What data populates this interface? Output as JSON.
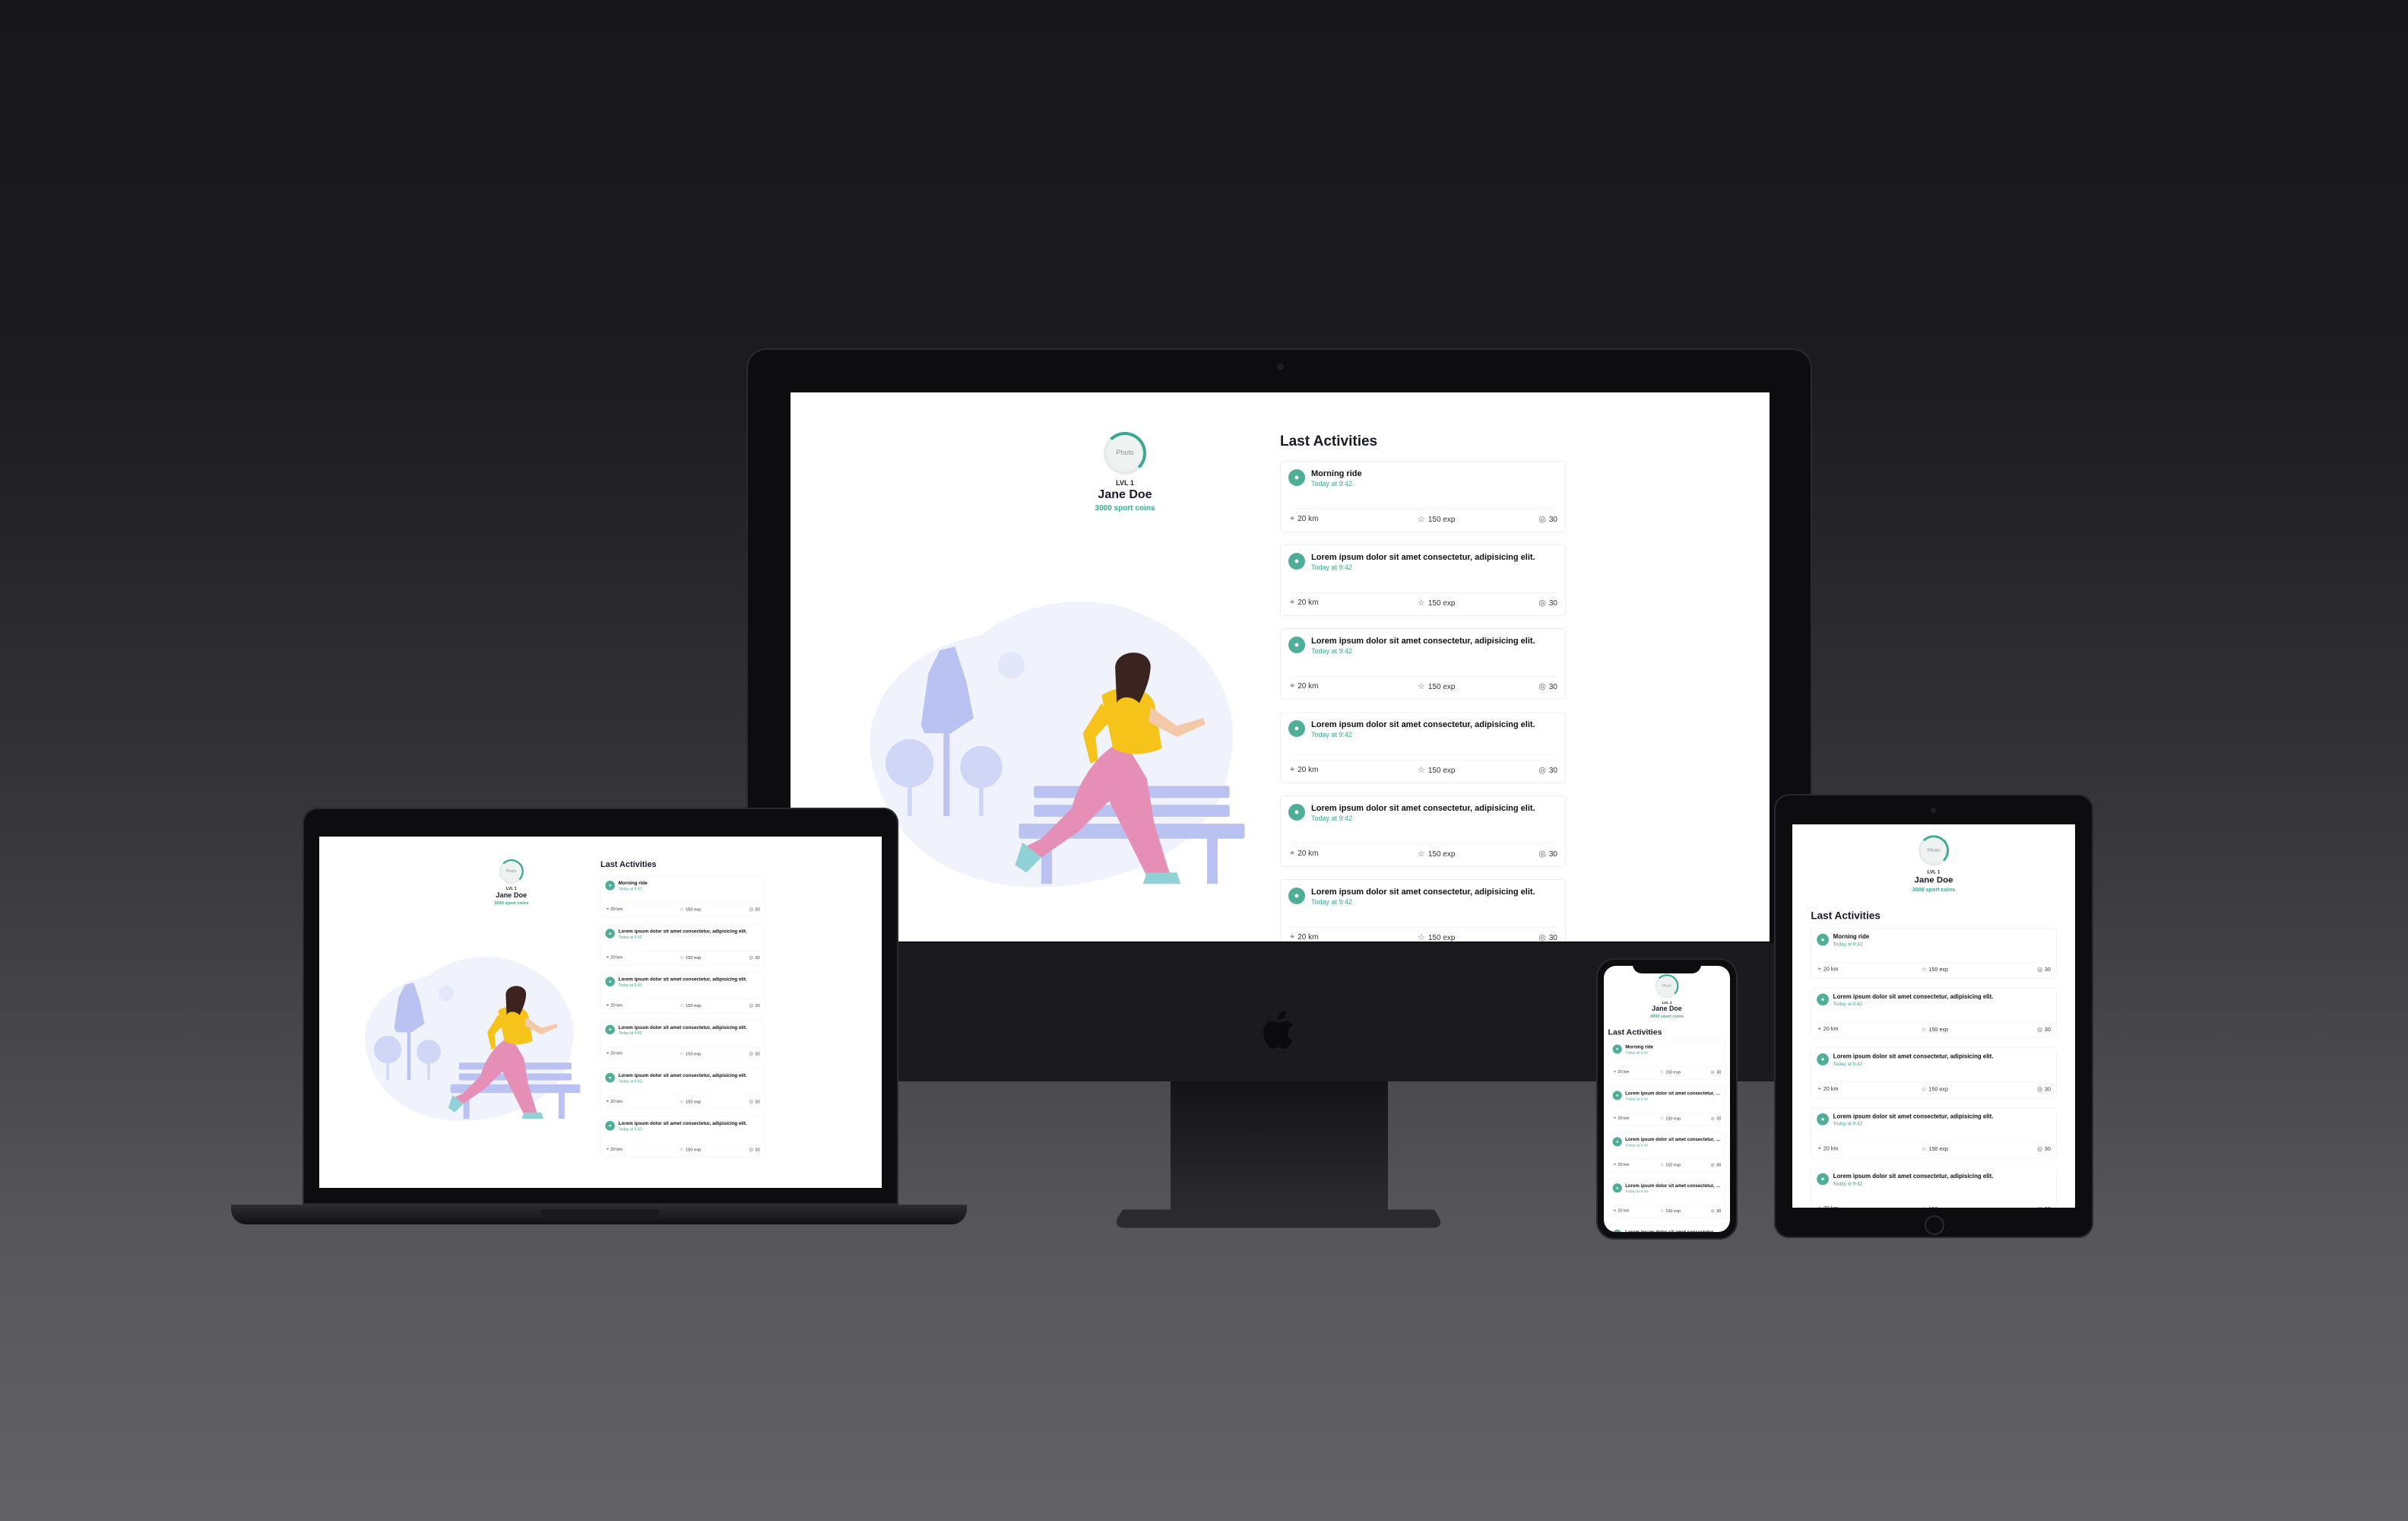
{
  "profile": {
    "photo_label": "Photo",
    "level": "LVL 1",
    "name": "Jane Doe",
    "coins": "3000 sport coins"
  },
  "activities": {
    "title": "Last Activities",
    "items": [
      {
        "title": "Morning ride",
        "time": "Today at 9:42",
        "distance": "20 km",
        "exp": "150 exp",
        "coins": "30",
        "icon": "bike-icon"
      },
      {
        "title": "Lorem ipsum dolor sit amet consectetur, adipisicing elit.",
        "time": "Today at 9:42",
        "distance": "20 km",
        "exp": "150 exp",
        "coins": "30",
        "icon": "run-icon"
      },
      {
        "title": "Lorem ipsum dolor sit amet consectetur, adipisicing elit.",
        "time": "Today at 9:42",
        "distance": "20 km",
        "exp": "150 exp",
        "coins": "30",
        "icon": "bike-icon"
      },
      {
        "title": "Lorem ipsum dolor sit amet consectetur, adipisicing elit.",
        "time": "Today at 9:42",
        "distance": "20 km",
        "exp": "150 exp",
        "coins": "30",
        "icon": "walk-icon"
      },
      {
        "title": "Lorem ipsum dolor sit amet consectetur, adipisicing elit.",
        "time": "Today at 9:42",
        "distance": "20 km",
        "exp": "150 exp",
        "coins": "30",
        "icon": "walk-icon"
      },
      {
        "title": "Lorem ipsum dolor sit amet consectetur, adipisicing elit.",
        "time": "Today at 9:42",
        "distance": "20 km",
        "exp": "150 exp",
        "coins": "30",
        "icon": "walk-icon"
      }
    ]
  },
  "icons": {
    "distance": "location-pin-icon",
    "exp": "star-icon",
    "coins": "coin-icon"
  },
  "colors": {
    "accent": "#3aa892",
    "illustration": "#b9c2f0",
    "shirt": "#f5c31a",
    "pants": "#e58fb7"
  }
}
